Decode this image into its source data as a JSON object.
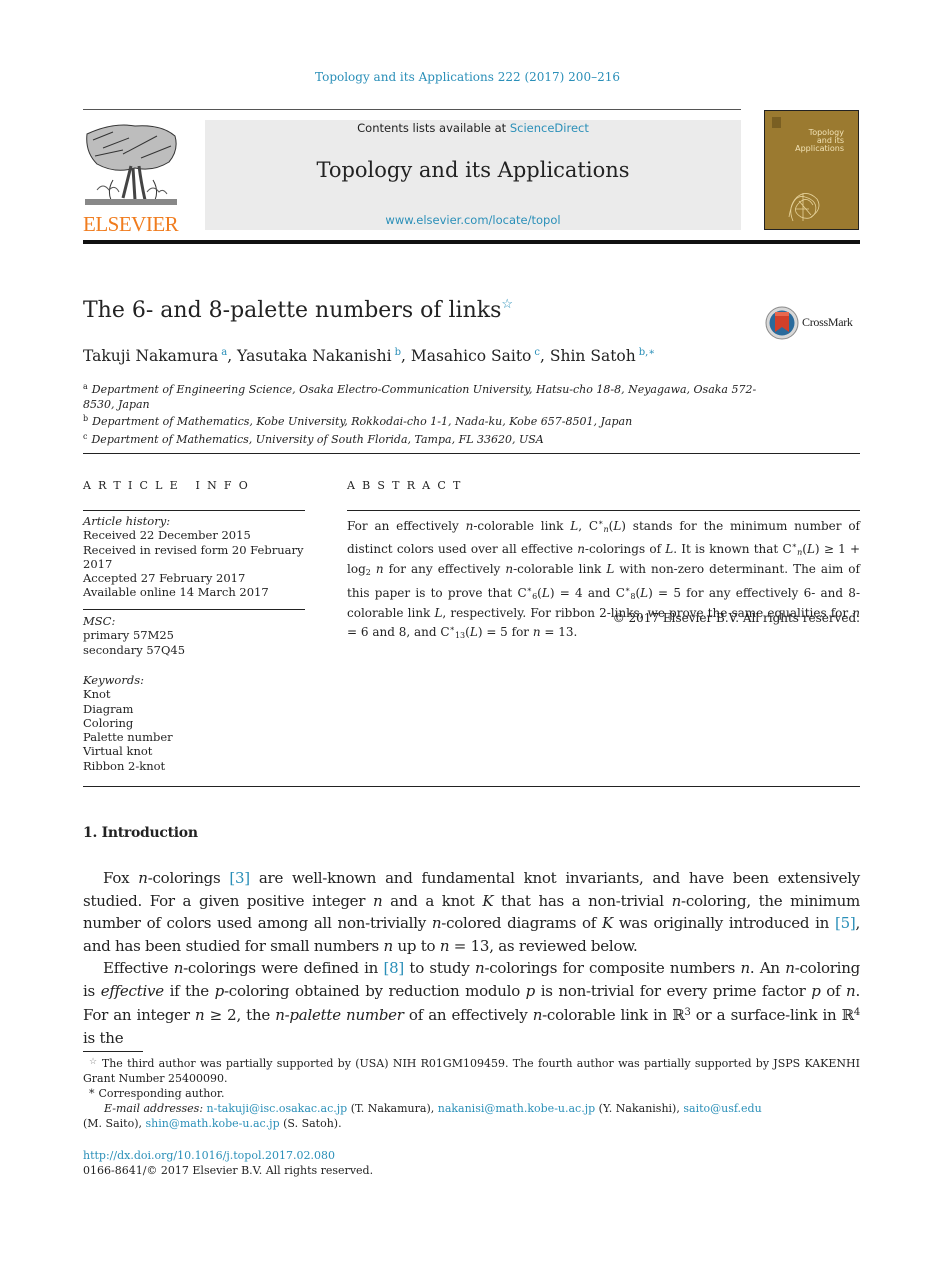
{
  "header": {
    "journal_reference": "Topology and its Applications 222 (2017) 200–216",
    "publisher_logo_text": "ELSEVIER",
    "contents_prefix": "Contents lists available at ",
    "contents_link": "ScienceDirect",
    "journal_name": "Topology and its Applications",
    "journal_url": "www.elsevier.com/locate/topol",
    "cover_title_lines": [
      "Topology",
      "and its",
      "Applications"
    ],
    "brand_color": "#f07c1e",
    "link_color": "#2a8fb8",
    "cover_color": "#9b7a30"
  },
  "article": {
    "title": "The 6- and 8-palette numbers of links",
    "title_note_icon": "star-icon",
    "crossmark_label": "CrossMark",
    "authors": [
      {
        "name": "Takuji Nakamura",
        "affil": "a"
      },
      {
        "name": "Yasutaka Nakanishi",
        "affil": "b"
      },
      {
        "name": "Masahico Saito",
        "affil": "c"
      },
      {
        "name": "Shin Satoh",
        "affil": "b,∗"
      }
    ],
    "affiliations": [
      {
        "mark": "a",
        "text": "Department of Engineering Science, Osaka Electro-Communication University, Hatsu-cho 18-8, Neyagawa, Osaka 572-8530, Japan"
      },
      {
        "mark": "b",
        "text": "Department of Mathematics, Kobe University, Rokkodai-cho 1-1, Nada-ku, Kobe 657-8501, Japan"
      },
      {
        "mark": "c",
        "text": "Department of Mathematics, University of South Florida, Tampa, FL 33620, USA"
      }
    ]
  },
  "article_info": {
    "heading": "ARTICLE INFO",
    "history_label": "Article history:",
    "history": [
      "Received 22 December 2015",
      "Received in revised form 20 February 2017",
      "Accepted 27 February 2017",
      "Available online 14 March 2017"
    ],
    "msc_label": "MSC:",
    "msc": [
      "primary 57M25",
      "secondary 57Q45"
    ],
    "keywords_label": "Keywords:",
    "keywords": [
      "Knot",
      "Diagram",
      "Coloring",
      "Palette number",
      "Virtual knot",
      "Ribbon 2-knot"
    ]
  },
  "abstract": {
    "heading": "ABSTRACT",
    "s1": "For an effectively ",
    "s2": "-colorable link ",
    "s3": " stands for the minimum number of distinct colors used over all effective ",
    "s4": "-colorings of ",
    "s5": ". It is known that ",
    "s6": " ≥ 1 + log",
    "s7": " for any effectively ",
    "s8": "-colorable link ",
    "s9": " with non-zero determinant. The aim of this paper is to prove that ",
    "s10": " = 4 and ",
    "s11": " = 5 for any effectively 6- and 8-colorable link ",
    "s12": ", respectively. For ribbon 2-links, we prove the same equalities for ",
    "s13": " = 6 and 8, and ",
    "s14": " = 5 for ",
    "s15": " = 13.",
    "copyright": "© 2017 Elsevier B.V. All rights reserved."
  },
  "body": {
    "section_heading": "1. Introduction",
    "p1": {
      "a": "Fox ",
      "b": "-colorings ",
      "ref1": "[3]",
      "c": " are well-known and fundamental knot invariants, and have been extensively studied. For a given positive integer ",
      "d": " and a knot ",
      "e": " that has a non-trivial ",
      "f": "-coloring, the minimum number of colors used among all non-trivially ",
      "g": "-colored diagrams of ",
      "h": " was originally introduced in ",
      "ref2": "[5]",
      "i": ", and has been studied for small numbers ",
      "j": " up to ",
      "k": " = 13, as reviewed below."
    },
    "p2": {
      "a": "Effective ",
      "b": "-colorings were defined in ",
      "ref1": "[8]",
      "c": " to study ",
      "d": "-colorings for composite numbers ",
      "e": ". An ",
      "f": "-coloring is ",
      "g_italic": "effective",
      "h": " if the ",
      "i": "-coloring obtained by reduction modulo ",
      "j": " is non-trivial for every prime factor ",
      "k": " of ",
      "l": ". For an integer ",
      "m": " ≥ 2, the ",
      "n_italic": "n-palette number",
      "o": " of an effectively ",
      "p": "-colorable link in ℝ",
      "q": " or a surface-link in ℝ",
      "r": " is the"
    }
  },
  "footnotes": {
    "funding": "The third author was partially supported by (USA) NIH R01GM109459. The fourth author was partially supported by JSPS KAKENHI Grant Number 25400090.",
    "corresponding_mark": "*",
    "corresponding": "Corresponding author.",
    "email_label": "E-mail addresses:",
    "emails": [
      {
        "address": "n-takuji@isc.osakac.ac.jp",
        "who": "(T. Nakamura),"
      },
      {
        "address": "nakanisi@math.kobe-u.ac.jp",
        "who": "(Y. Nakanishi),"
      },
      {
        "address": "saito@usf.edu",
        "who": "(M. Saito),"
      },
      {
        "address": "shin@math.kobe-u.ac.jp",
        "who": "(S. Satoh)."
      }
    ],
    "doi": "http://dx.doi.org/10.1016/j.topol.2017.02.080",
    "issn_line": "0166-8641/© 2017 Elsevier B.V. All rights reserved."
  }
}
